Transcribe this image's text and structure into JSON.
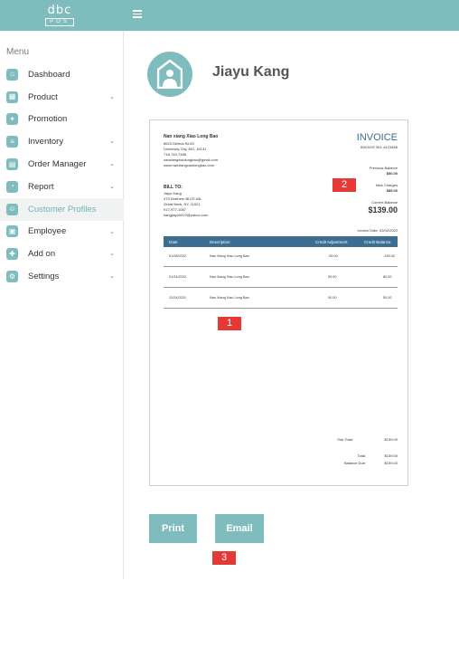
{
  "brand": {
    "logo_top": "dbc",
    "logo_bottom": "POS"
  },
  "sidebar": {
    "menu_label": "Menu",
    "items": [
      {
        "label": "Dashboard",
        "icon": "dashboard-icon",
        "chevron": false,
        "active": false
      },
      {
        "label": "Product",
        "icon": "product-icon",
        "chevron": true,
        "active": false
      },
      {
        "label": "Promotion",
        "icon": "promotion-icon",
        "chevron": false,
        "active": false
      },
      {
        "label": "Inventory",
        "icon": "inventory-icon",
        "chevron": true,
        "active": false
      },
      {
        "label": "Order Manager",
        "icon": "order-icon",
        "chevron": true,
        "active": false
      },
      {
        "label": "Report",
        "icon": "report-icon",
        "chevron": true,
        "active": false
      },
      {
        "label": "Customer Profiles",
        "icon": "customer-icon",
        "chevron": false,
        "active": true
      },
      {
        "label": "Employee",
        "icon": "employee-icon",
        "chevron": true,
        "active": false
      },
      {
        "label": "Add on",
        "icon": "addon-icon",
        "chevron": true,
        "active": false
      },
      {
        "label": "Settings",
        "icon": "settings-icon",
        "chevron": true,
        "active": false
      }
    ]
  },
  "customer": {
    "name": "Jiayu Kang"
  },
  "invoice": {
    "company": {
      "name": "Nan xiang Xiao Long Bao",
      "address1": "6623 Delmar BLVD",
      "address2": "University City, MO, 16131",
      "phone": "718-749-7488",
      "email": "nanxiangxiaolongbao@gmail.com",
      "website": "www.nanxiangxiaolongbao.com"
    },
    "title": "INVOICE",
    "number": "INVOICE NO: #123456",
    "previous_balance_label": "Previous Balance",
    "previous_balance": "$50.00",
    "new_charges_label": "New Charges",
    "new_charges": "$89.00",
    "current_balance_label": "Current Balance",
    "current_balance": "$139.00",
    "bill_to": {
      "label": "BILL TO:",
      "name": "Jiayu Kang",
      "address1": "475 Northern BLVD #3L",
      "address2": "Great Neck, NY, 11021",
      "phone": "917-977-1067",
      "email": "kangjiayu0022@yahoo.com"
    },
    "invoice_date": "Invoice Date: 02/02/2022",
    "columns": [
      "Date",
      "Description",
      "Credit Adjustment",
      "Credit Balance"
    ],
    "rows": [
      {
        "date": "01/28/2022",
        "description": "Nan Xiang Xiao Long Bao",
        "adjustment": "-39.00",
        "balance": "-139.00"
      },
      {
        "date": "01/24/2022",
        "description": "Nan Xiang Xiao Long Bao",
        "adjustment": "00.00",
        "balance": "80.00"
      },
      {
        "date": "12/24/2021",
        "description": "Nan Xiang Xiao Long Bao",
        "adjustment": "00.00",
        "balance": "50.00"
      }
    ],
    "sub_total_label": "Sub Total:",
    "sub_total": "$139.00",
    "total_label": "Total:",
    "total": "$139.00",
    "balance_due_label": "Balance Due:",
    "balance_due": "$139.00"
  },
  "markers": {
    "m1": "1",
    "m2": "2",
    "m3": "3"
  },
  "actions": {
    "print": "Print",
    "email": "Email"
  },
  "colors": {
    "accent": "#7fbcbd",
    "invoice_blue": "#3c6e91",
    "marker_red": "#e53935"
  }
}
